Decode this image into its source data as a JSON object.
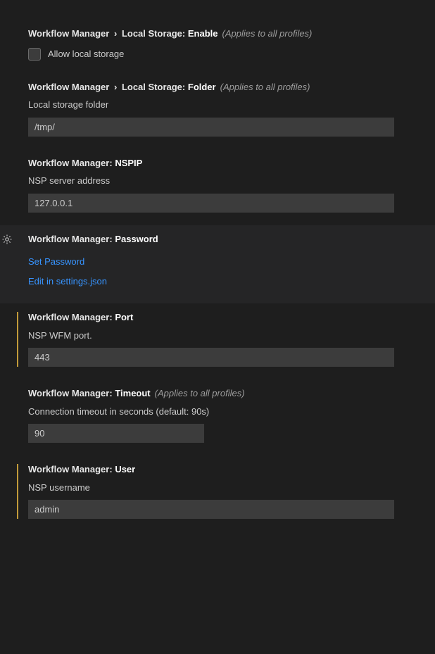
{
  "common": {
    "categoryLabel": "Workflow Manager",
    "subcategoryLabel": "Local Storage",
    "scopeNote": "(Applies to all profiles)"
  },
  "settings": {
    "enable": {
      "key": "Enable",
      "checkboxLabel": "Allow local storage"
    },
    "folder": {
      "key": "Folder",
      "desc": "Local storage folder",
      "value": "/tmp/"
    },
    "nspip": {
      "key": "NSPIP",
      "desc": "NSP server address",
      "value": "127.0.0.1"
    },
    "password": {
      "key": "Password",
      "setLink": "Set Password",
      "editLink": "Edit in settings.json"
    },
    "port": {
      "key": "Port",
      "desc": "NSP WFM port.",
      "value": "443"
    },
    "timeout": {
      "key": "Timeout",
      "desc": "Connection timeout in seconds (default: 90s)",
      "value": "90"
    },
    "user": {
      "key": "User",
      "desc": "NSP username",
      "value": "admin"
    }
  },
  "icons": {
    "gear": "gear-icon"
  }
}
